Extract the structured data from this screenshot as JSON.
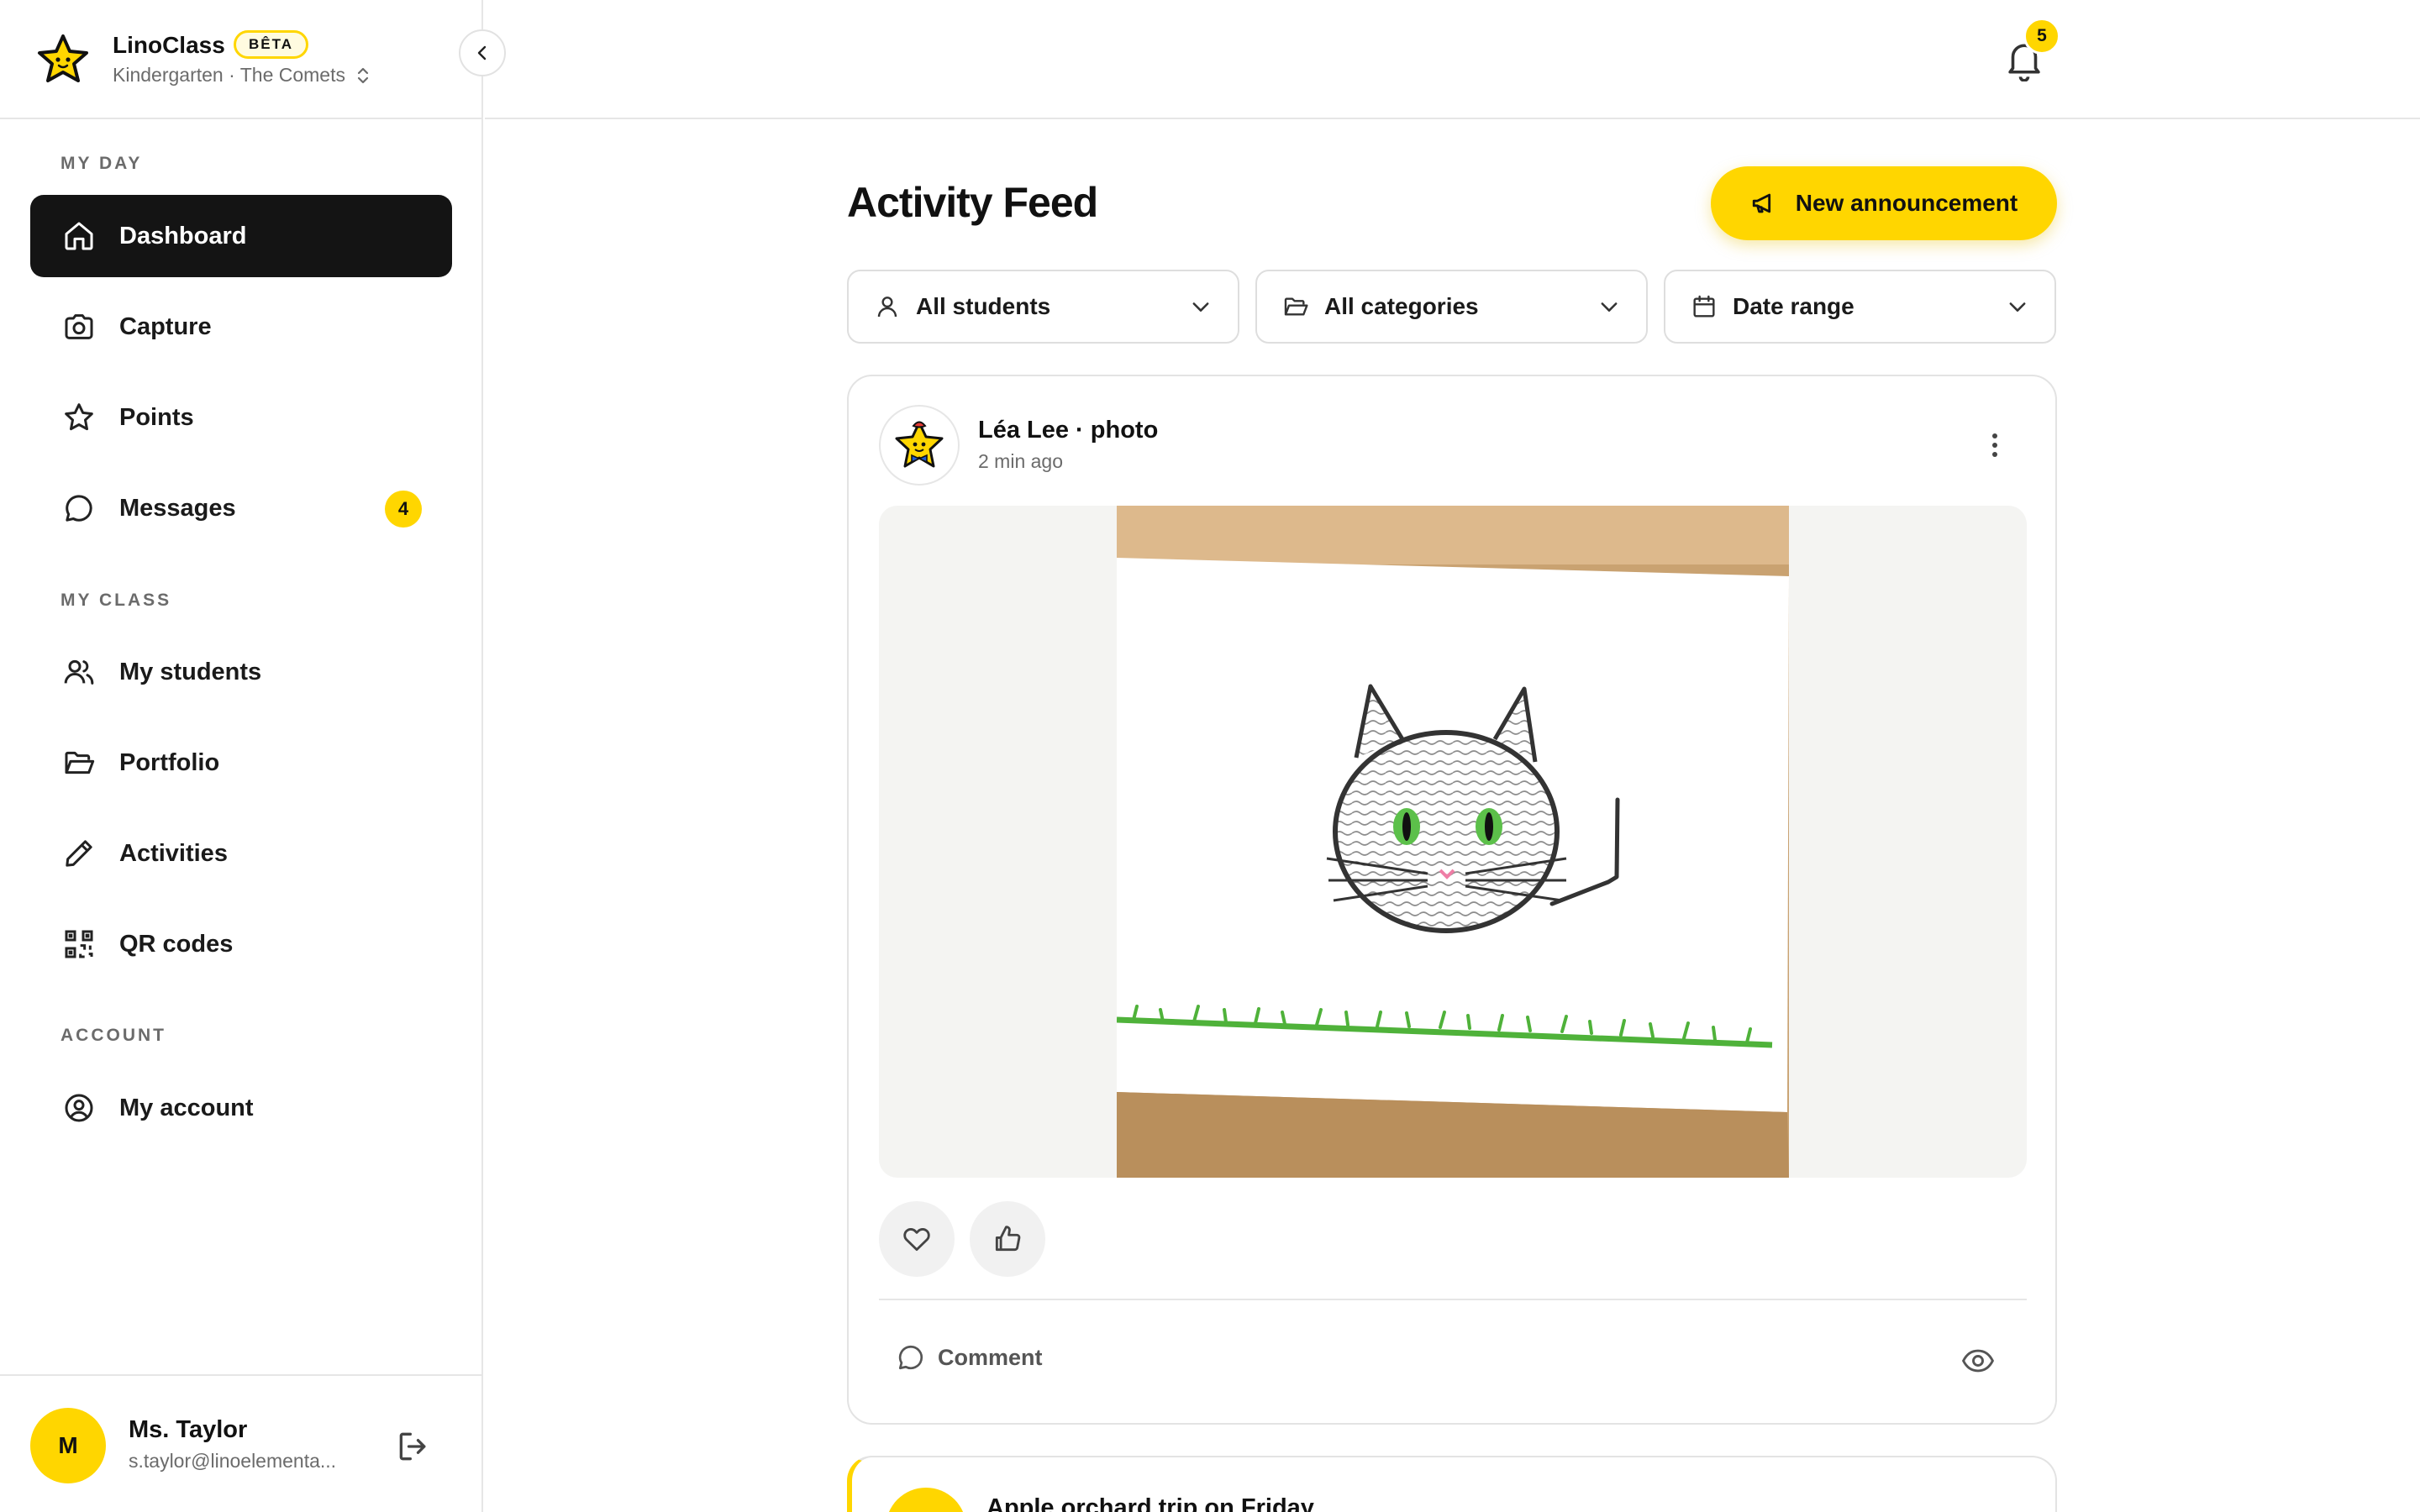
{
  "app": {
    "name": "LinoClass",
    "badge": "BÊTA",
    "class_context": "Kindergarten · The Comets"
  },
  "sidebar": {
    "sections": [
      {
        "label": "MY DAY"
      },
      {
        "label": "MY CLASS"
      },
      {
        "label": "ACCOUNT"
      }
    ],
    "items": [
      {
        "label": "Dashboard",
        "icon": "home-icon",
        "active": true
      },
      {
        "label": "Capture",
        "icon": "camera-icon"
      },
      {
        "label": "Points",
        "icon": "star-icon"
      },
      {
        "label": "Messages",
        "icon": "message-icon",
        "badge": "4"
      },
      {
        "label": "My students",
        "icon": "users-icon"
      },
      {
        "label": "Portfolio",
        "icon": "folder-icon"
      },
      {
        "label": "Activities",
        "icon": "pencil-icon"
      },
      {
        "label": "QR codes",
        "icon": "qr-code-icon"
      },
      {
        "label": "My account",
        "icon": "user-circle-icon"
      }
    ]
  },
  "user": {
    "initial": "M",
    "name": "Ms. Taylor",
    "email": "s.taylor@linoelementa..."
  },
  "topbar": {
    "notifications_count": "5"
  },
  "main": {
    "title": "Activity Feed",
    "new_announcement": "New announcement",
    "filters": [
      {
        "label": "All students",
        "icon": "person-icon"
      },
      {
        "label": "All categories",
        "icon": "folder-icon"
      },
      {
        "label": "Date range",
        "icon": "calendar-icon"
      }
    ]
  },
  "feed": [
    {
      "author_line": "Léa Lee · photo",
      "time": "2 min ago",
      "actions": {
        "comment": "Comment"
      }
    },
    {
      "title": "Apple orchard trip on Friday"
    }
  ],
  "colors": {
    "accent": "#ffd600",
    "active_nav": "#141414",
    "muted": "#6b6b6b",
    "border": "#e6e6e6"
  }
}
